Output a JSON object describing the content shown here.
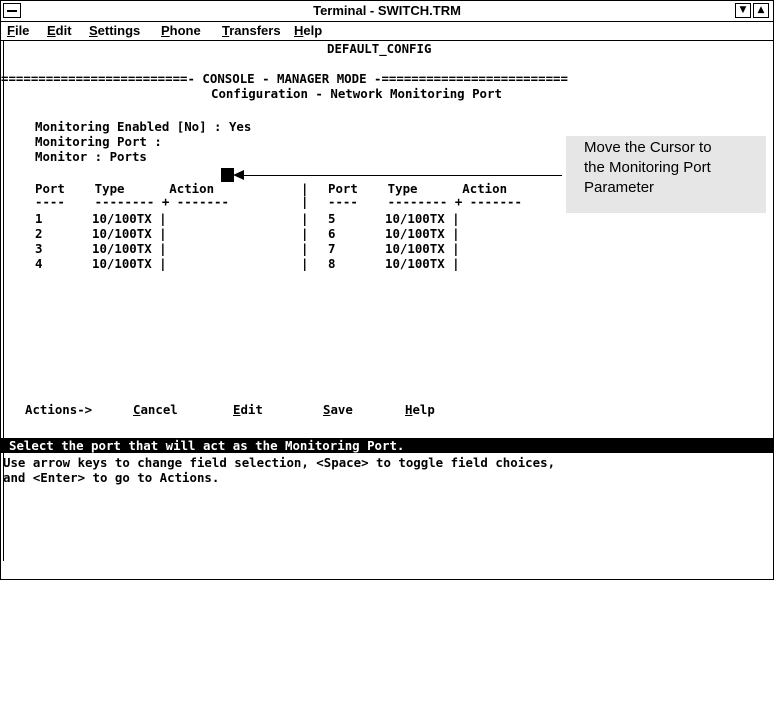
{
  "window": {
    "title": "Terminal - SWITCH.TRM"
  },
  "menu": [
    {
      "label": "File",
      "key": "F"
    },
    {
      "label": "Edit",
      "key": "E"
    },
    {
      "label": "Settings",
      "key": "S"
    },
    {
      "label": "Phone",
      "key": "P"
    },
    {
      "label": "Transfers",
      "key": "T"
    },
    {
      "label": "Help",
      "key": "H"
    }
  ],
  "screen": {
    "config_name": "DEFAULT_CONFIG",
    "mode_line": "=========================- CONSOLE - MANAGER MODE -=========================",
    "page_title": "Configuration - Network Monitoring Port",
    "monitoring_enabled": "Monitoring Enabled [No] : Yes",
    "monitoring_port": "Monitoring Port :",
    "monitor": "Monitor : Ports",
    "table_header_left": "Port    Type      Action",
    "table_header_right": "Port    Type      Action",
    "table_dash_left": "----    -------- + -------",
    "table_dash_right": "----    -------- + -------",
    "rows_left": [
      {
        "port": "1",
        "type": "10/100TX"
      },
      {
        "port": "2",
        "type": "10/100TX"
      },
      {
        "port": "3",
        "type": "10/100TX"
      },
      {
        "port": "4",
        "type": "10/100TX"
      }
    ],
    "rows_right": [
      {
        "port": "5",
        "type": "10/100TX"
      },
      {
        "port": "6",
        "type": "10/100TX"
      },
      {
        "port": "7",
        "type": "10/100TX"
      },
      {
        "port": "8",
        "type": "10/100TX"
      }
    ],
    "actions_label": "Actions->",
    "actions": [
      {
        "label": "Cancel",
        "key": "C"
      },
      {
        "label": "Edit",
        "key": "E"
      },
      {
        "label": "Save",
        "key": "S"
      },
      {
        "label": "Help",
        "key": "H"
      }
    ],
    "status_line": "Select the port that will act as the Monitoring Port.",
    "help_line1": "Use arrow keys to change field selection, <Space> to toggle field choices,",
    "help_line2": "and <Enter> to go to Actions."
  },
  "callout": {
    "lines": [
      "Move the Cursor to",
      "the Monitoring Port",
      "Parameter"
    ]
  }
}
